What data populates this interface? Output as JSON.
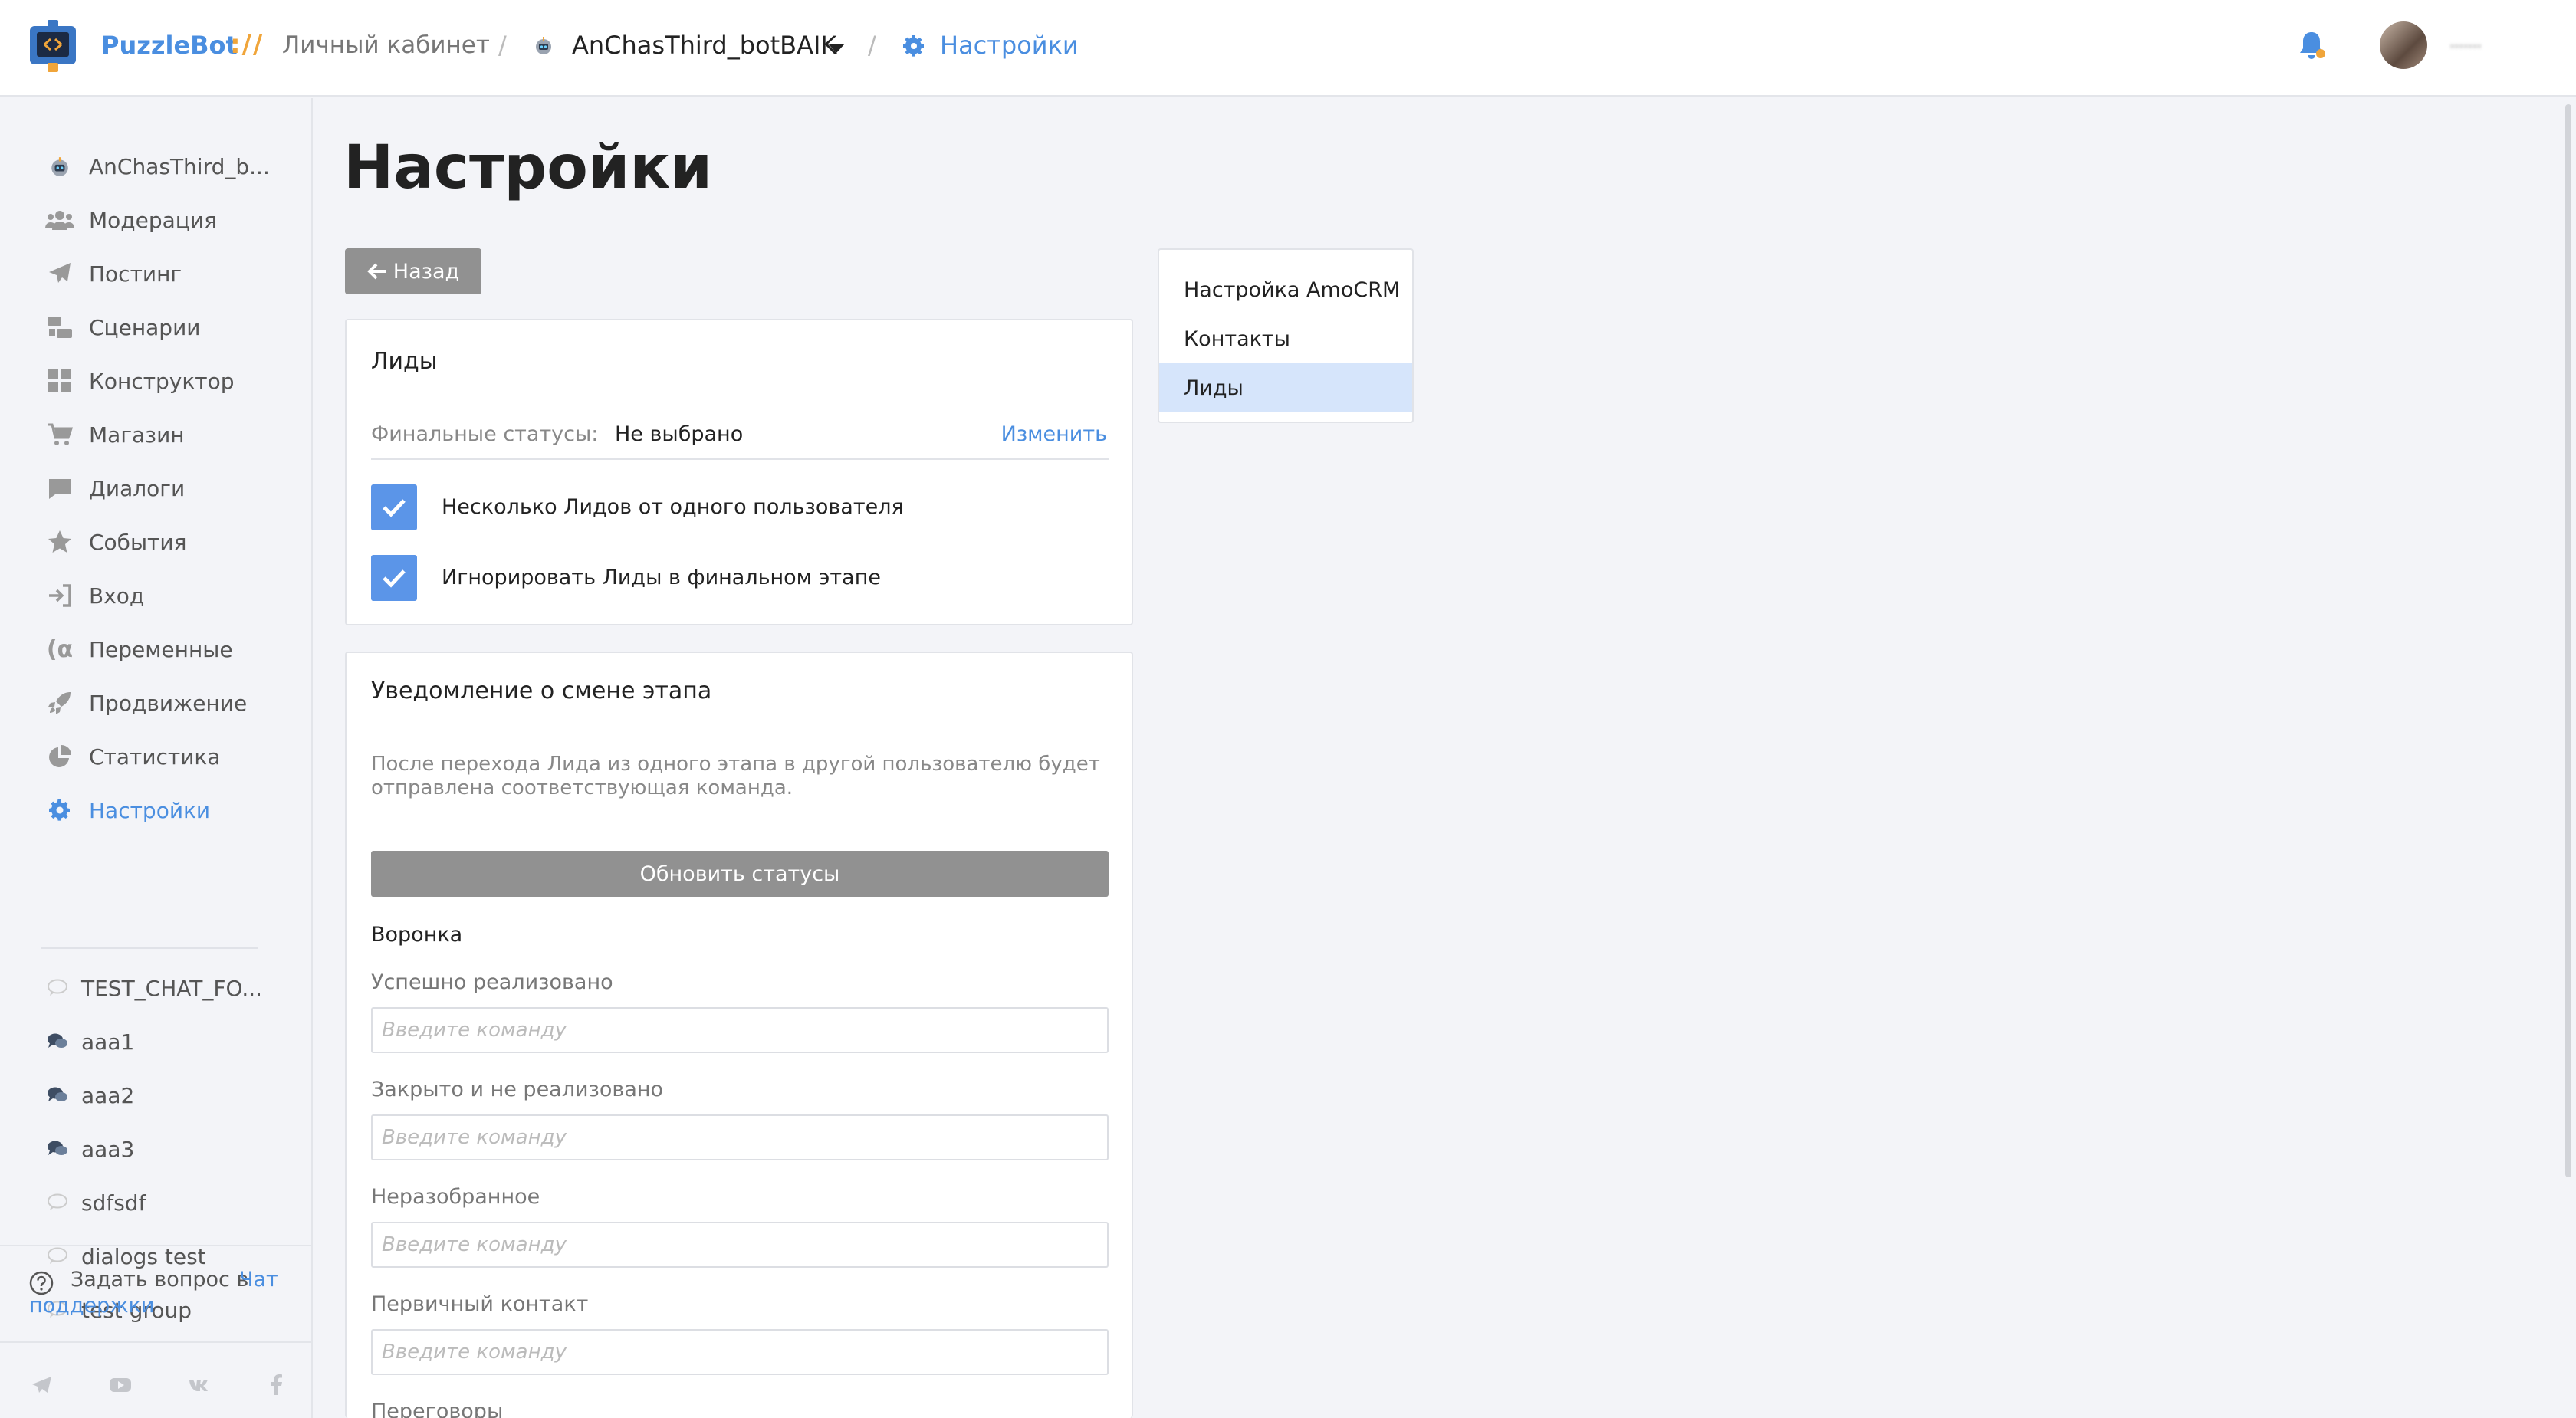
{
  "header": {
    "brand": "PuzzleBot",
    "brand_sep": "://",
    "cabinet": "Личный кабинет",
    "bot_name": "AnChasThird_botBAIK",
    "current": "Настройки",
    "username": "·······"
  },
  "sidebar": {
    "nav": [
      {
        "label": "AnChasThird_b...",
        "icon": "bot-icon"
      },
      {
        "label": "Модерация",
        "icon": "users-icon"
      },
      {
        "label": "Постинг",
        "icon": "paper-plane-icon"
      },
      {
        "label": "Сценарии",
        "icon": "scenario-icon"
      },
      {
        "label": "Конструктор",
        "icon": "grid-icon"
      },
      {
        "label": "Магазин",
        "icon": "cart-icon"
      },
      {
        "label": "Диалоги",
        "icon": "comment-icon"
      },
      {
        "label": "События",
        "icon": "star-icon"
      },
      {
        "label": "Вход",
        "icon": "sign-in-icon"
      },
      {
        "label": "Переменные",
        "icon": "variable-icon"
      },
      {
        "label": "Продвижение",
        "icon": "rocket-icon"
      },
      {
        "label": "Статистика",
        "icon": "pie-chart-icon"
      },
      {
        "label": "Настройки",
        "icon": "gear-icon"
      }
    ],
    "chats": [
      {
        "label": "TEST_CHAT_FO...",
        "icon": "chat-bubble-icon"
      },
      {
        "label": "aaa1",
        "icon": "group-chat-icon"
      },
      {
        "label": "aaa2",
        "icon": "group-chat-icon"
      },
      {
        "label": "aaa3",
        "icon": "group-chat-icon"
      },
      {
        "label": "sdfsdf",
        "icon": "chat-bubble-icon"
      },
      {
        "label": "dialogs test",
        "icon": "chat-bubble-icon"
      },
      {
        "label": "test group",
        "icon": "chat-bubble-icon"
      }
    ],
    "help_text": "Задать вопрос в",
    "help_link_1": "Чат",
    "help_link_2": "поддержки"
  },
  "main": {
    "title": "Настройки",
    "back_label": "Назад",
    "leads_card": {
      "title": "Лиды",
      "final_status_label": "Финальные статусы:",
      "final_status_value": "Не выбрано",
      "change_link": "Изменить",
      "checkboxes": [
        {
          "label": "Несколько Лидов от одного пользователя",
          "checked": true
        },
        {
          "label": "Игнорировать Лиды в финальном этапе",
          "checked": true
        }
      ]
    },
    "notify_card": {
      "title": "Уведомление о смене этапа",
      "description": "После перехода Лида из одного этапа в другой пользователю будет отправлена соответствующая команда.",
      "update_button": "Обновить статусы",
      "funnel_label": "Воронка",
      "input_placeholder": "Введите команду",
      "stages": [
        "Успешно реализовано",
        "Закрыто и не реализовано",
        "Неразобранное",
        "Первичный контакт",
        "Переговоры"
      ]
    }
  },
  "right_menu": {
    "items": [
      {
        "label": "Настройка AmoCRM",
        "active": false
      },
      {
        "label": "Контакты",
        "active": false
      },
      {
        "label": "Лиды",
        "active": true
      }
    ]
  },
  "colors": {
    "accent": "#4a8ee0",
    "brand_sep": "#f0a53a",
    "checkbox": "#5b95e8",
    "button_gray": "#919191",
    "menu_active": "#d6e5fb"
  }
}
